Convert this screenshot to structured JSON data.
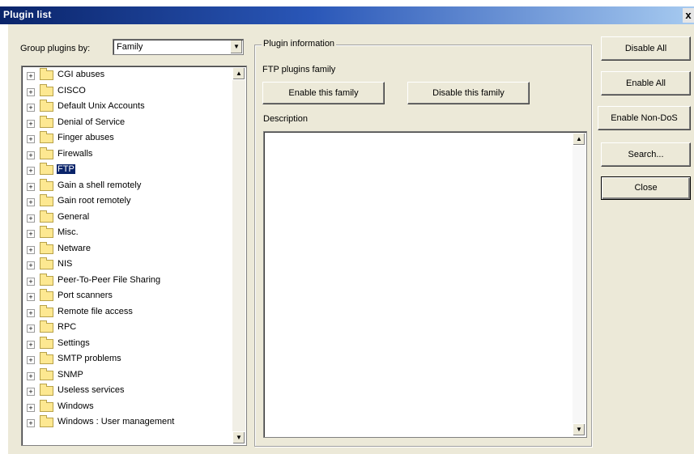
{
  "window": {
    "title": "Plugin list",
    "close_glyph": "x"
  },
  "group_by": {
    "label": "Group plugins by:",
    "value": "Family"
  },
  "tree": {
    "selected_index": 6,
    "items": [
      "CGI abuses",
      "CISCO",
      "Default Unix Accounts",
      "Denial of Service",
      "Finger abuses",
      "Firewalls",
      "FTP",
      "Gain a shell remotely",
      "Gain root remotely",
      "General",
      "Misc.",
      "Netware",
      "NIS",
      "Peer-To-Peer File Sharing",
      "Port scanners",
      "Remote file access",
      "RPC",
      "Settings",
      "SMTP problems",
      "SNMP",
      "Useless services",
      "Windows",
      "Windows : User management"
    ]
  },
  "plugin_info": {
    "caption": "Plugin information",
    "family_label": "FTP plugins family",
    "enable_family_label": "Enable this family",
    "disable_family_label": "Disable this family",
    "description_label": "Description",
    "description_text": ""
  },
  "actions": {
    "disable_all": "Disable All",
    "enable_all": "Enable All",
    "enable_non_dos": "Enable Non-DoS",
    "search": "Search...",
    "close": "Close"
  },
  "icons": {
    "expand": "plus-box-icon",
    "folder": "folder-icon",
    "scroll_up": "arrow-up-icon",
    "scroll_down": "arrow-down-icon",
    "dropdown": "chevron-down-icon"
  },
  "colors": {
    "title_start": "#0a246a",
    "title_end": "#a6caf0",
    "dialog_bg": "#ece9d8",
    "selection_bg": "#0a246a",
    "folder": "#fde891"
  }
}
